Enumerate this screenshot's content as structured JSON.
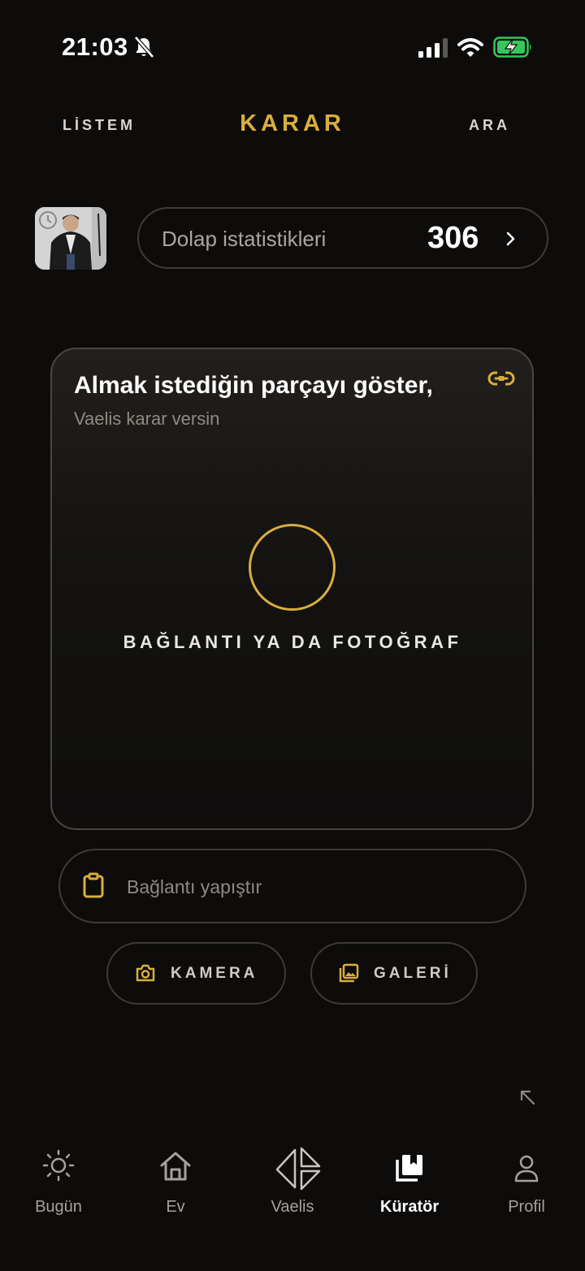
{
  "status_bar": {
    "time": "21:03"
  },
  "top_nav": {
    "left": "LİSTEM",
    "center": "KARAR",
    "right": "ARA"
  },
  "stats": {
    "label": "Dolap istatistikleri",
    "count": "306"
  },
  "upload_card": {
    "title": "Almak istediğin parçayı göster,",
    "subtitle": "Vaelis karar versin",
    "cta": "BAĞLANTI YA DA FOTOĞRAF"
  },
  "paste": {
    "placeholder": "Bağlantı yapıştır"
  },
  "buttons": {
    "camera": "KAMERA",
    "gallery": "GALERİ"
  },
  "bottom_nav": [
    {
      "label": "Bugün",
      "icon": "sun-icon"
    },
    {
      "label": "Ev",
      "icon": "home-icon"
    },
    {
      "label": "Vaelis",
      "icon": "vaelis-logo-icon"
    },
    {
      "label": "Küratör",
      "icon": "curator-cards-icon",
      "active": true
    },
    {
      "label": "Profil",
      "icon": "person-icon"
    }
  ],
  "colors": {
    "accent": "#d9ae3d",
    "background": "#0d0c0b",
    "battery": "#34c759"
  }
}
